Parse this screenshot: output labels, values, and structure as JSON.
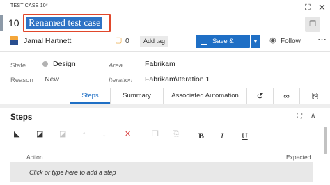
{
  "header": {
    "work_item_type": "TEST CASE 10*",
    "id": "10",
    "title": "Renamed test case",
    "icons": {
      "expand": "expand-icon",
      "close": "close-icon",
      "copy": "copy-icon"
    }
  },
  "toolbar": {
    "assigned_to": "Jamal Hartnett",
    "comment_count": "0",
    "add_tag_label": "Add tag",
    "save_label": "Save & Close",
    "follow_label": "Follow",
    "accent_color": "#1f6fc5"
  },
  "fields": {
    "state_label": "State",
    "state_value": "Design",
    "reason_label": "Reason",
    "reason_value": "New",
    "area_label": "Area",
    "area_value": "Fabrikam",
    "iteration_label": "Iteration",
    "iteration_value": "Fabrikam\\Iteration 1"
  },
  "tabs": [
    {
      "label": "Steps",
      "active": true
    },
    {
      "label": "Summary",
      "active": false
    },
    {
      "label": "Associated Automation",
      "active": false
    }
  ],
  "steps": {
    "title": "Steps",
    "toolbar_text": {
      "bold": "B",
      "italic": "I",
      "underline": "U"
    },
    "column_action": "Action",
    "column_expected": "Expected",
    "placeholder": "Click or type here to add a step"
  }
}
